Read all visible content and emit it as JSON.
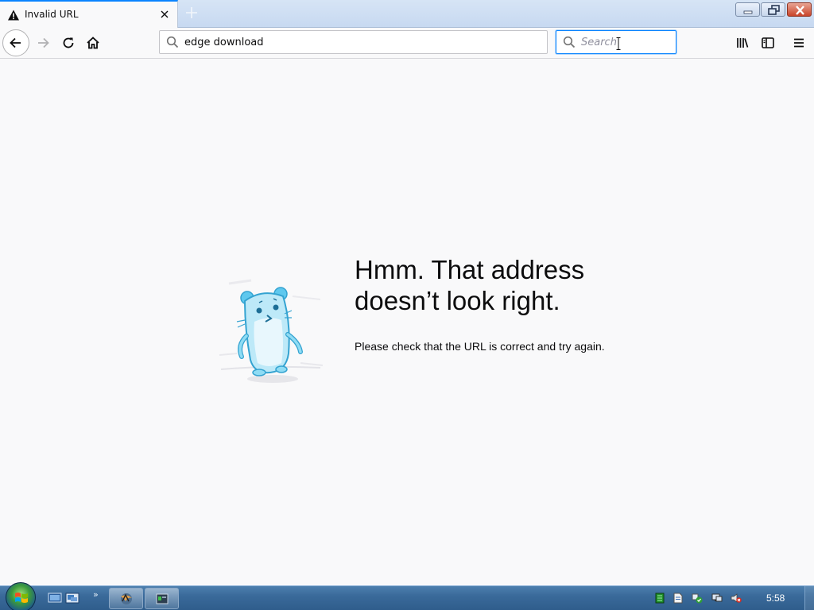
{
  "browser": {
    "tab": {
      "title": "Invalid URL"
    },
    "url": {
      "value": "edge download"
    },
    "search": {
      "placeholder": "Search",
      "value": ""
    }
  },
  "error_page": {
    "title": "Hmm. That address doesn’t look right.",
    "description": "Please check that the URL is correct and try again."
  },
  "taskbar": {
    "clock": "5:58"
  },
  "colors": {
    "accent": "#0a84ff",
    "mascot": "#5fc8ee",
    "page_bg": "#f9f9fa"
  },
  "icons": [
    "warning-icon",
    "close-icon",
    "plus-icon",
    "back-arrow-icon",
    "forward-arrow-icon",
    "reload-icon",
    "home-icon",
    "search-icon",
    "library-icon",
    "sidebar-icon",
    "hamburger-menu-icon"
  ]
}
